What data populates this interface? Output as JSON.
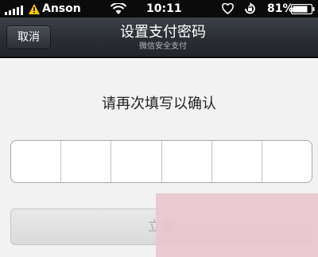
{
  "status_bar": {
    "carrier": "Anson",
    "time": "10:11",
    "battery": "81%",
    "icons": [
      "signal-icon",
      "warning-icon",
      "wifi-icon",
      "heart-icon",
      "orientation-lock-icon",
      "battery-icon"
    ]
  },
  "nav": {
    "cancel_label": "取消",
    "title": "设置支付密码",
    "subtitle": "微信安全支付"
  },
  "main": {
    "prompt": "请再次填写以确认",
    "pin_digits": 6,
    "confirm_label": "立即"
  },
  "colors": {
    "nav_background": "#2a2e33",
    "content_background": "#f2f2f2",
    "confirm_text_disabled": "#a9a9a9"
  }
}
